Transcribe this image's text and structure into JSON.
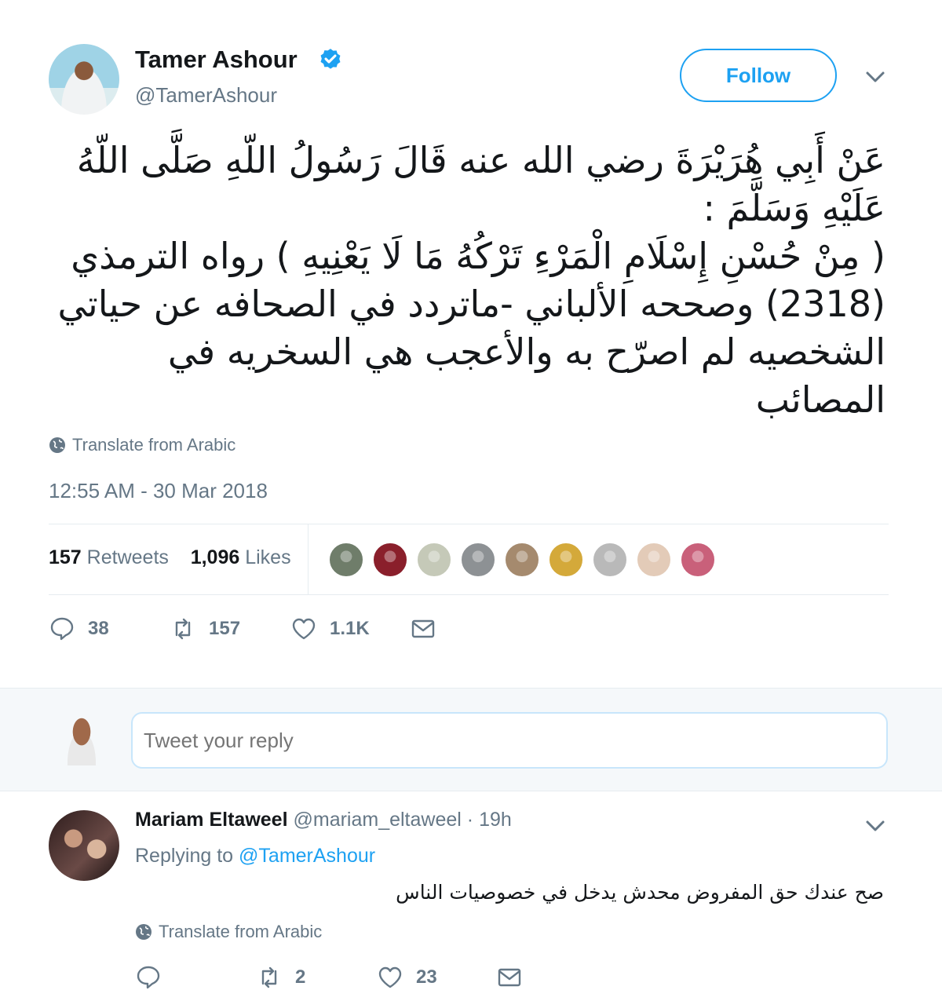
{
  "tweet": {
    "author_name": "Tamer Ashour",
    "author_handle": "@TamerAshour",
    "follow_label": "Follow",
    "text": "عَنْ أَبِي هُرَيْرَةَ رضي الله عنه قَالَ رَسُولُ اللّهِ صَلَّى اللّهُ عَلَيْهِ وَسَلَّمَ :\n( مِنْ حُسْنِ إِسْلَامِ الْمَرْءِ تَرْكُهُ مَا لَا يَعْنِيهِ ) رواه الترمذي (2318) وصححه الألباني -ماتردد في الصحافه عن حياتي الشخصيه لم اصرّح به والأعجب هي السخريه في المصائب",
    "translate_label": "Translate from Arabic",
    "timestamp": "12:55 AM - 30 Mar 2018",
    "retweets_count": "157",
    "retweets_label": "Retweets",
    "likes_count": "1,096",
    "likes_label": "Likes",
    "liker_avatar_colors": [
      "#6f7d6a",
      "#8a1f2b",
      "#c5c9b8",
      "#8d9194",
      "#a58a6e",
      "#d4a93a",
      "#b9b9b9",
      "#e3cbb8",
      "#c9607a"
    ],
    "actions": {
      "replies": "38",
      "retweets": "157",
      "likes": "1.1K"
    }
  },
  "reply_box": {
    "placeholder": "Tweet your reply"
  },
  "reply": {
    "author_name": "Mariam Eltaweel",
    "author_handle": "@mariam_eltaweel",
    "time": "19h",
    "replying_prefix": "Replying to",
    "replying_to": "@TamerAshour",
    "text": "صح عندك حق المفروض محدش يدخل في خصوصيات الناس",
    "translate_label": "Translate from Arabic",
    "actions": {
      "retweets": "2",
      "likes": "23"
    }
  },
  "colors": {
    "accent": "#1da1f2",
    "muted": "#657786",
    "text": "#14171a",
    "reply_bar_bg": "#f5f8fa"
  },
  "icons": [
    "verified-badge-icon",
    "chevron-down-icon",
    "globe-icon",
    "reply-icon",
    "retweet-icon",
    "like-icon",
    "message-icon"
  ]
}
